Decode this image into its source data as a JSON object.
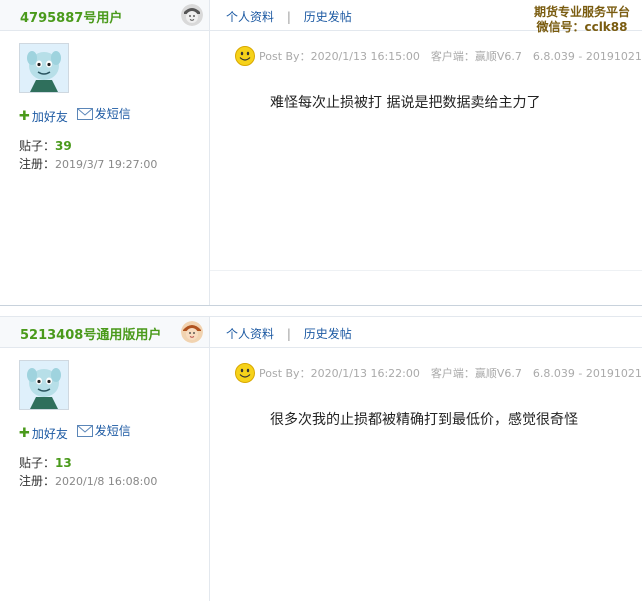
{
  "brand": {
    "line1": "期货专业服务平台",
    "line2": "微信号：cclk88"
  },
  "posts": [
    {
      "username": "4795887号用户",
      "actions": {
        "add_friend": "加好友",
        "send_message": "发短信"
      },
      "stats": {
        "posts_label": "贴子：",
        "posts_count": "39",
        "register_label": "注册：",
        "register_date": "2019/3/7 19:27:00"
      },
      "nav": {
        "profile": "个人资料",
        "separator": "|",
        "history": "历史发帖"
      },
      "meta": {
        "post_by": "Post By：2020/1/13 16:15:00",
        "client": "客户端：赢顺V6.7",
        "version": "6.8.039 - 20191021"
      },
      "content": "难怪每次止损被打 据说是把数据卖给主力了"
    },
    {
      "username": "5213408号通用版用户",
      "actions": {
        "add_friend": "加好友",
        "send_message": "发短信"
      },
      "stats": {
        "posts_label": "贴子：",
        "posts_count": "13",
        "register_label": "注册：",
        "register_date": "2020/1/8 16:08:00"
      },
      "nav": {
        "profile": "个人资料",
        "separator": "|",
        "history": "历史发帖"
      },
      "meta": {
        "post_by": "Post By：2020/1/13 16:22:00",
        "client": "客户端：赢顺V6.7",
        "version": "6.8.039 - 20191021"
      },
      "content": "很多次我的止损都被精确打到最低价，感觉很奇怪"
    }
  ]
}
